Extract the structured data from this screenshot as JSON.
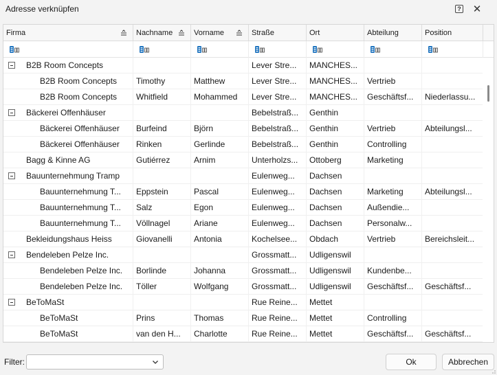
{
  "window": {
    "title": "Adresse verknüpfen",
    "help_label": "?",
    "close_label": "✕"
  },
  "columns": [
    {
      "key": "firma",
      "label": "Firma",
      "sortable": true
    },
    {
      "key": "nachname",
      "label": "Nachname",
      "sortable": true
    },
    {
      "key": "vorname",
      "label": "Vorname",
      "sortable": true
    },
    {
      "key": "strasse",
      "label": "Straße",
      "sortable": false
    },
    {
      "key": "ort",
      "label": "Ort",
      "sortable": false
    },
    {
      "key": "abteilung",
      "label": "Abteilung",
      "sortable": false
    },
    {
      "key": "position",
      "label": "Position",
      "sortable": false
    }
  ],
  "filter_row_icon": "abc-text-filter-icon",
  "rows": [
    {
      "level": 0,
      "expandable": true,
      "firma": "B2B Room Concepts",
      "nachname": "",
      "vorname": "",
      "strasse": "Lever Stre...",
      "ort": "MANCHES...",
      "abteilung": "",
      "position": ""
    },
    {
      "level": 1,
      "expandable": false,
      "firma": "B2B Room Concepts",
      "nachname": "Timothy",
      "vorname": "Matthew",
      "strasse": "Lever Stre...",
      "ort": "MANCHES...",
      "abteilung": "Vertrieb",
      "position": ""
    },
    {
      "level": 1,
      "expandable": false,
      "firma": "B2B Room Concepts",
      "nachname": "Whitfield",
      "vorname": "Mohammed",
      "strasse": "Lever Stre...",
      "ort": "MANCHES...",
      "abteilung": "Geschäftsf...",
      "position": "Niederlassu..."
    },
    {
      "level": 0,
      "expandable": true,
      "firma": "Bäckerei Offenhäuser",
      "nachname": "",
      "vorname": "",
      "strasse": "Bebelstraß...",
      "ort": "Genthin",
      "abteilung": "",
      "position": ""
    },
    {
      "level": 1,
      "expandable": false,
      "firma": "Bäckerei Offenhäuser",
      "nachname": "Burfeind",
      "vorname": "Björn",
      "strasse": "Bebelstraß...",
      "ort": "Genthin",
      "abteilung": "Vertrieb",
      "position": "Abteilungsl..."
    },
    {
      "level": 1,
      "expandable": false,
      "firma": "Bäckerei Offenhäuser",
      "nachname": "Rinken",
      "vorname": "Gerlinde",
      "strasse": "Bebelstraß...",
      "ort": "Genthin",
      "abteilung": "Controlling",
      "position": ""
    },
    {
      "level": 0,
      "expandable": false,
      "firma": "Bagg & Kinne AG",
      "nachname": "Gutiérrez",
      "vorname": "Arnim",
      "strasse": "Unterholzs...",
      "ort": "Ottoberg",
      "abteilung": "Marketing",
      "position": ""
    },
    {
      "level": 0,
      "expandable": true,
      "firma": "Bauunternehmung Tramp",
      "nachname": "",
      "vorname": "",
      "strasse": "Eulenweg...",
      "ort": "Dachsen",
      "abteilung": "",
      "position": ""
    },
    {
      "level": 1,
      "expandable": false,
      "firma": "Bauunternehmung T...",
      "nachname": "Eppstein",
      "vorname": "Pascal",
      "strasse": "Eulenweg...",
      "ort": "Dachsen",
      "abteilung": "Marketing",
      "position": "Abteilungsl..."
    },
    {
      "level": 1,
      "expandable": false,
      "firma": "Bauunternehmung T...",
      "nachname": "Salz",
      "vorname": "Egon",
      "strasse": "Eulenweg...",
      "ort": "Dachsen",
      "abteilung": "Außendie...",
      "position": ""
    },
    {
      "level": 1,
      "expandable": false,
      "firma": "Bauunternehmung T...",
      "nachname": "Völlnagel",
      "vorname": "Ariane",
      "strasse": "Eulenweg...",
      "ort": "Dachsen",
      "abteilung": "Personalw...",
      "position": ""
    },
    {
      "level": 0,
      "expandable": false,
      "firma": "Bekleidungshaus Heiss",
      "nachname": "Giovanelli",
      "vorname": "Antonia",
      "strasse": "Kochelsee...",
      "ort": "Obdach",
      "abteilung": "Vertrieb",
      "position": "Bereichsleit..."
    },
    {
      "level": 0,
      "expandable": true,
      "firma": "Bendeleben Pelze Inc.",
      "nachname": "",
      "vorname": "",
      "strasse": "Grossmatt...",
      "ort": "Udligenswil",
      "abteilung": "",
      "position": ""
    },
    {
      "level": 1,
      "expandable": false,
      "firma": "Bendeleben Pelze Inc.",
      "nachname": "Borlinde",
      "vorname": "Johanna",
      "strasse": "Grossmatt...",
      "ort": "Udligenswil",
      "abteilung": "Kundenbe...",
      "position": ""
    },
    {
      "level": 1,
      "expandable": false,
      "firma": "Bendeleben Pelze Inc.",
      "nachname": "Töller",
      "vorname": "Wolfgang",
      "strasse": "Grossmatt...",
      "ort": "Udligenswil",
      "abteilung": "Geschäftsf...",
      "position": "Geschäftsf..."
    },
    {
      "level": 0,
      "expandable": true,
      "firma": "BeToMaSt",
      "nachname": "",
      "vorname": "",
      "strasse": "Rue Reine...",
      "ort": "Mettet",
      "abteilung": "",
      "position": ""
    },
    {
      "level": 1,
      "expandable": false,
      "firma": "BeToMaSt",
      "nachname": "Prins",
      "vorname": "Thomas",
      "strasse": "Rue Reine...",
      "ort": "Mettet",
      "abteilung": "Controlling",
      "position": ""
    },
    {
      "level": 1,
      "expandable": false,
      "firma": "BeToMaSt",
      "nachname": "van den H...",
      "vorname": "Charlotte",
      "strasse": "Rue Reine...",
      "ort": "Mettet",
      "abteilung": "Geschäftsf...",
      "position": "Geschäftsf..."
    }
  ],
  "footer": {
    "filter_label": "Filter:",
    "filter_value": "",
    "ok_label": "Ok",
    "cancel_label": "Abbrechen"
  }
}
